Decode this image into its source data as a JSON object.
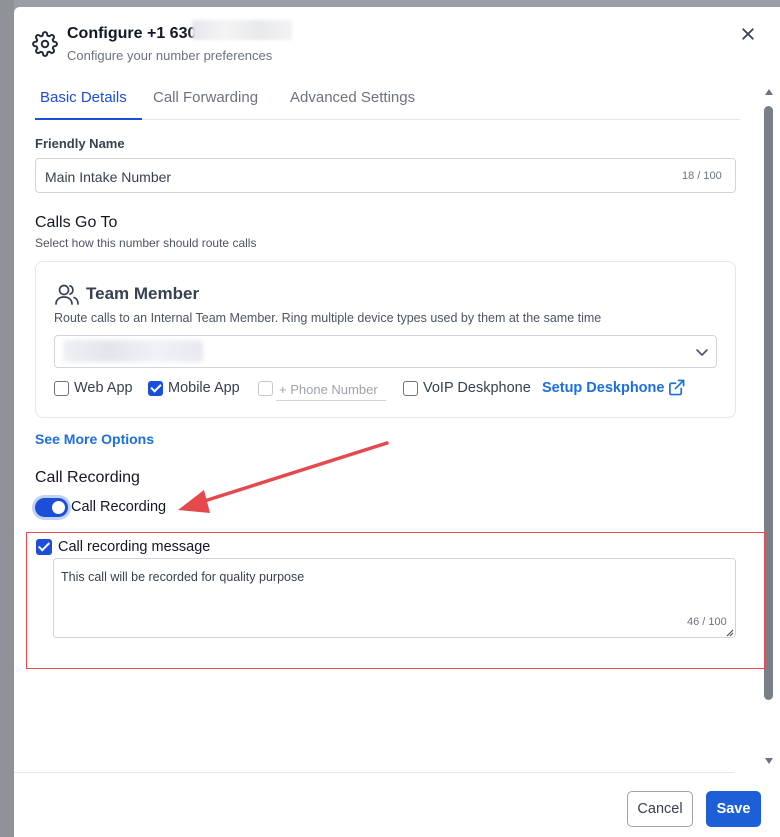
{
  "header": {
    "title": "Configure +1 630-",
    "subtitle": "Configure your number preferences",
    "icon": "gear-icon"
  },
  "tabs": [
    {
      "label": "Basic Details",
      "active": true
    },
    {
      "label": "Call Forwarding",
      "active": false
    },
    {
      "label": "Advanced Settings",
      "active": false
    }
  ],
  "friendly_name": {
    "label": "Friendly Name",
    "value": "Main Intake Number",
    "counter": "18 / 100"
  },
  "calls_go_to": {
    "title": "Calls Go To",
    "subtitle": "Select how this number should route calls"
  },
  "team_member": {
    "title": "Team Member",
    "description": "Route calls to an Internal Team Member. Ring multiple device types used by them at the same time",
    "options": {
      "web_app": {
        "label": "Web App",
        "checked": false
      },
      "mobile_app": {
        "label": "Mobile App",
        "checked": true
      },
      "phone_number": {
        "placeholder": "+ Phone Number",
        "checked": false
      },
      "voip": {
        "label": "VoIP Deskphone",
        "checked": false
      }
    },
    "setup_link": "Setup Deskphone"
  },
  "see_more": "See More Options",
  "call_recording": {
    "title": "Call Recording",
    "toggle_label": "Call Recording",
    "toggle_on": true,
    "message_label": "Call recording message",
    "message_checked": true,
    "message_value": "This call will be recorded for quality purpose",
    "message_counter": "46 / 100"
  },
  "footer": {
    "cancel": "Cancel",
    "save": "Save"
  },
  "colors": {
    "accent": "#1d4ed8",
    "link": "#1d6fdc",
    "highlight": "#e5484d"
  }
}
